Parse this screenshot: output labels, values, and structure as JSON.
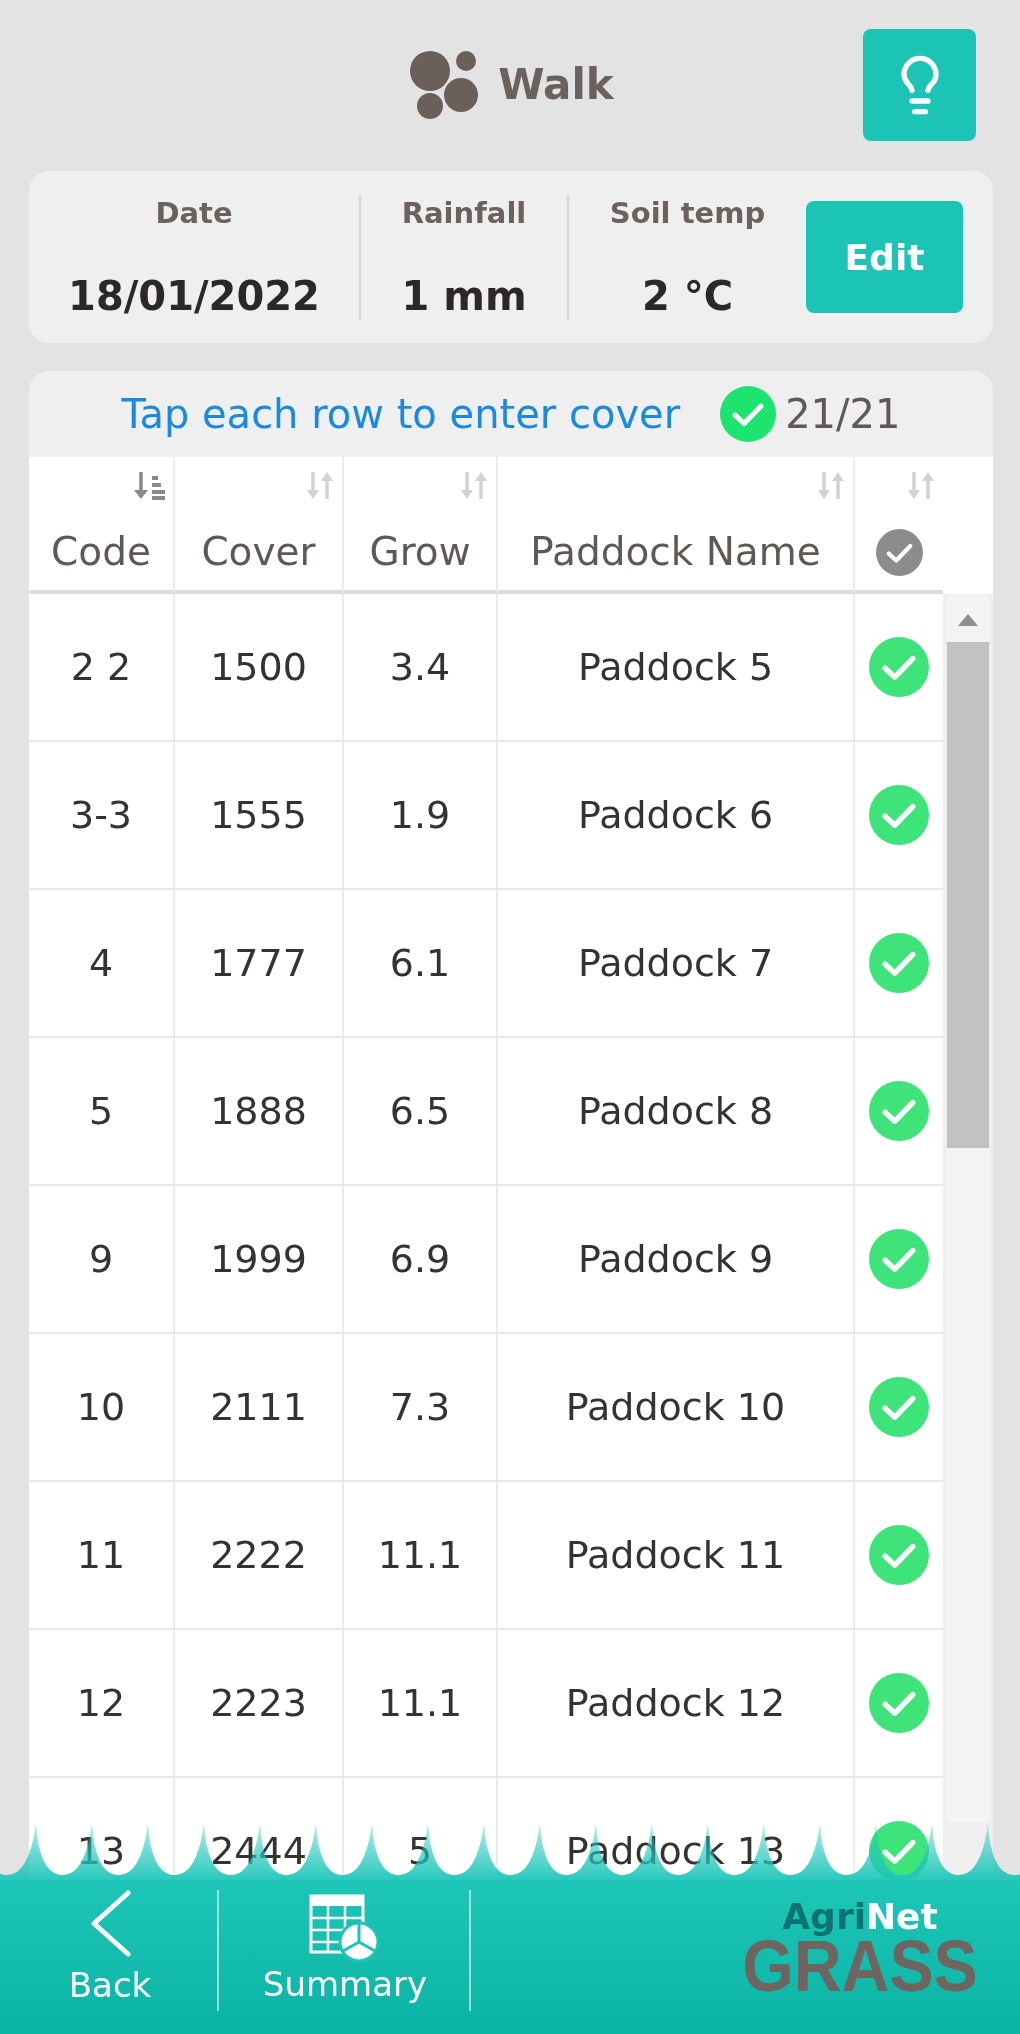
{
  "header": {
    "title": "Walk"
  },
  "conditions": [
    {
      "label": "Date",
      "value": "18/01/2022"
    },
    {
      "label": "Rainfall",
      "value": "1 mm"
    },
    {
      "label": "Soil temp",
      "value": "2 °C"
    }
  ],
  "edit_button": {
    "label": "Edit"
  },
  "progress": {
    "hint": "Tap each row to enter cover",
    "complete": true,
    "count": "21/21"
  },
  "table": {
    "columns": [
      {
        "kind": "text",
        "label": "Code",
        "sorted": true
      },
      {
        "kind": "text",
        "label": "Cover",
        "sorted": false
      },
      {
        "kind": "text",
        "label": "Grow",
        "sorted": false
      },
      {
        "kind": "text",
        "label": "Paddock Name",
        "sorted": false
      },
      {
        "kind": "status",
        "sorted": false
      }
    ],
    "rows": [
      {
        "cells": [
          "2 2",
          "1500",
          "3.4",
          "Paddock 5"
        ],
        "done": true
      },
      {
        "cells": [
          "3-3",
          "1555",
          "1.9",
          "Paddock 6"
        ],
        "done": true
      },
      {
        "cells": [
          "4",
          "1777",
          "6.1",
          "Paddock 7"
        ],
        "done": true
      },
      {
        "cells": [
          "5",
          "1888",
          "6.5",
          "Paddock 8"
        ],
        "done": true
      },
      {
        "cells": [
          "9",
          "1999",
          "6.9",
          "Paddock 9"
        ],
        "done": true
      },
      {
        "cells": [
          "10",
          "2111",
          "7.3",
          "Paddock 10"
        ],
        "done": true
      },
      {
        "cells": [
          "11",
          "2222",
          "11.1",
          "Paddock 11"
        ],
        "done": true
      },
      {
        "cells": [
          "12",
          "2223",
          "11.1",
          "Paddock 12"
        ],
        "done": true
      },
      {
        "cells": [
          "13",
          "2444",
          "5",
          "Paddock 13"
        ],
        "done": true
      }
    ]
  },
  "bottom_bar": {
    "buttons": [
      {
        "kind": "back",
        "label": "Back"
      },
      {
        "kind": "summary",
        "label": "Summary"
      }
    ],
    "logo": {
      "name": "AgriNet",
      "title": "GRASS"
    }
  }
}
